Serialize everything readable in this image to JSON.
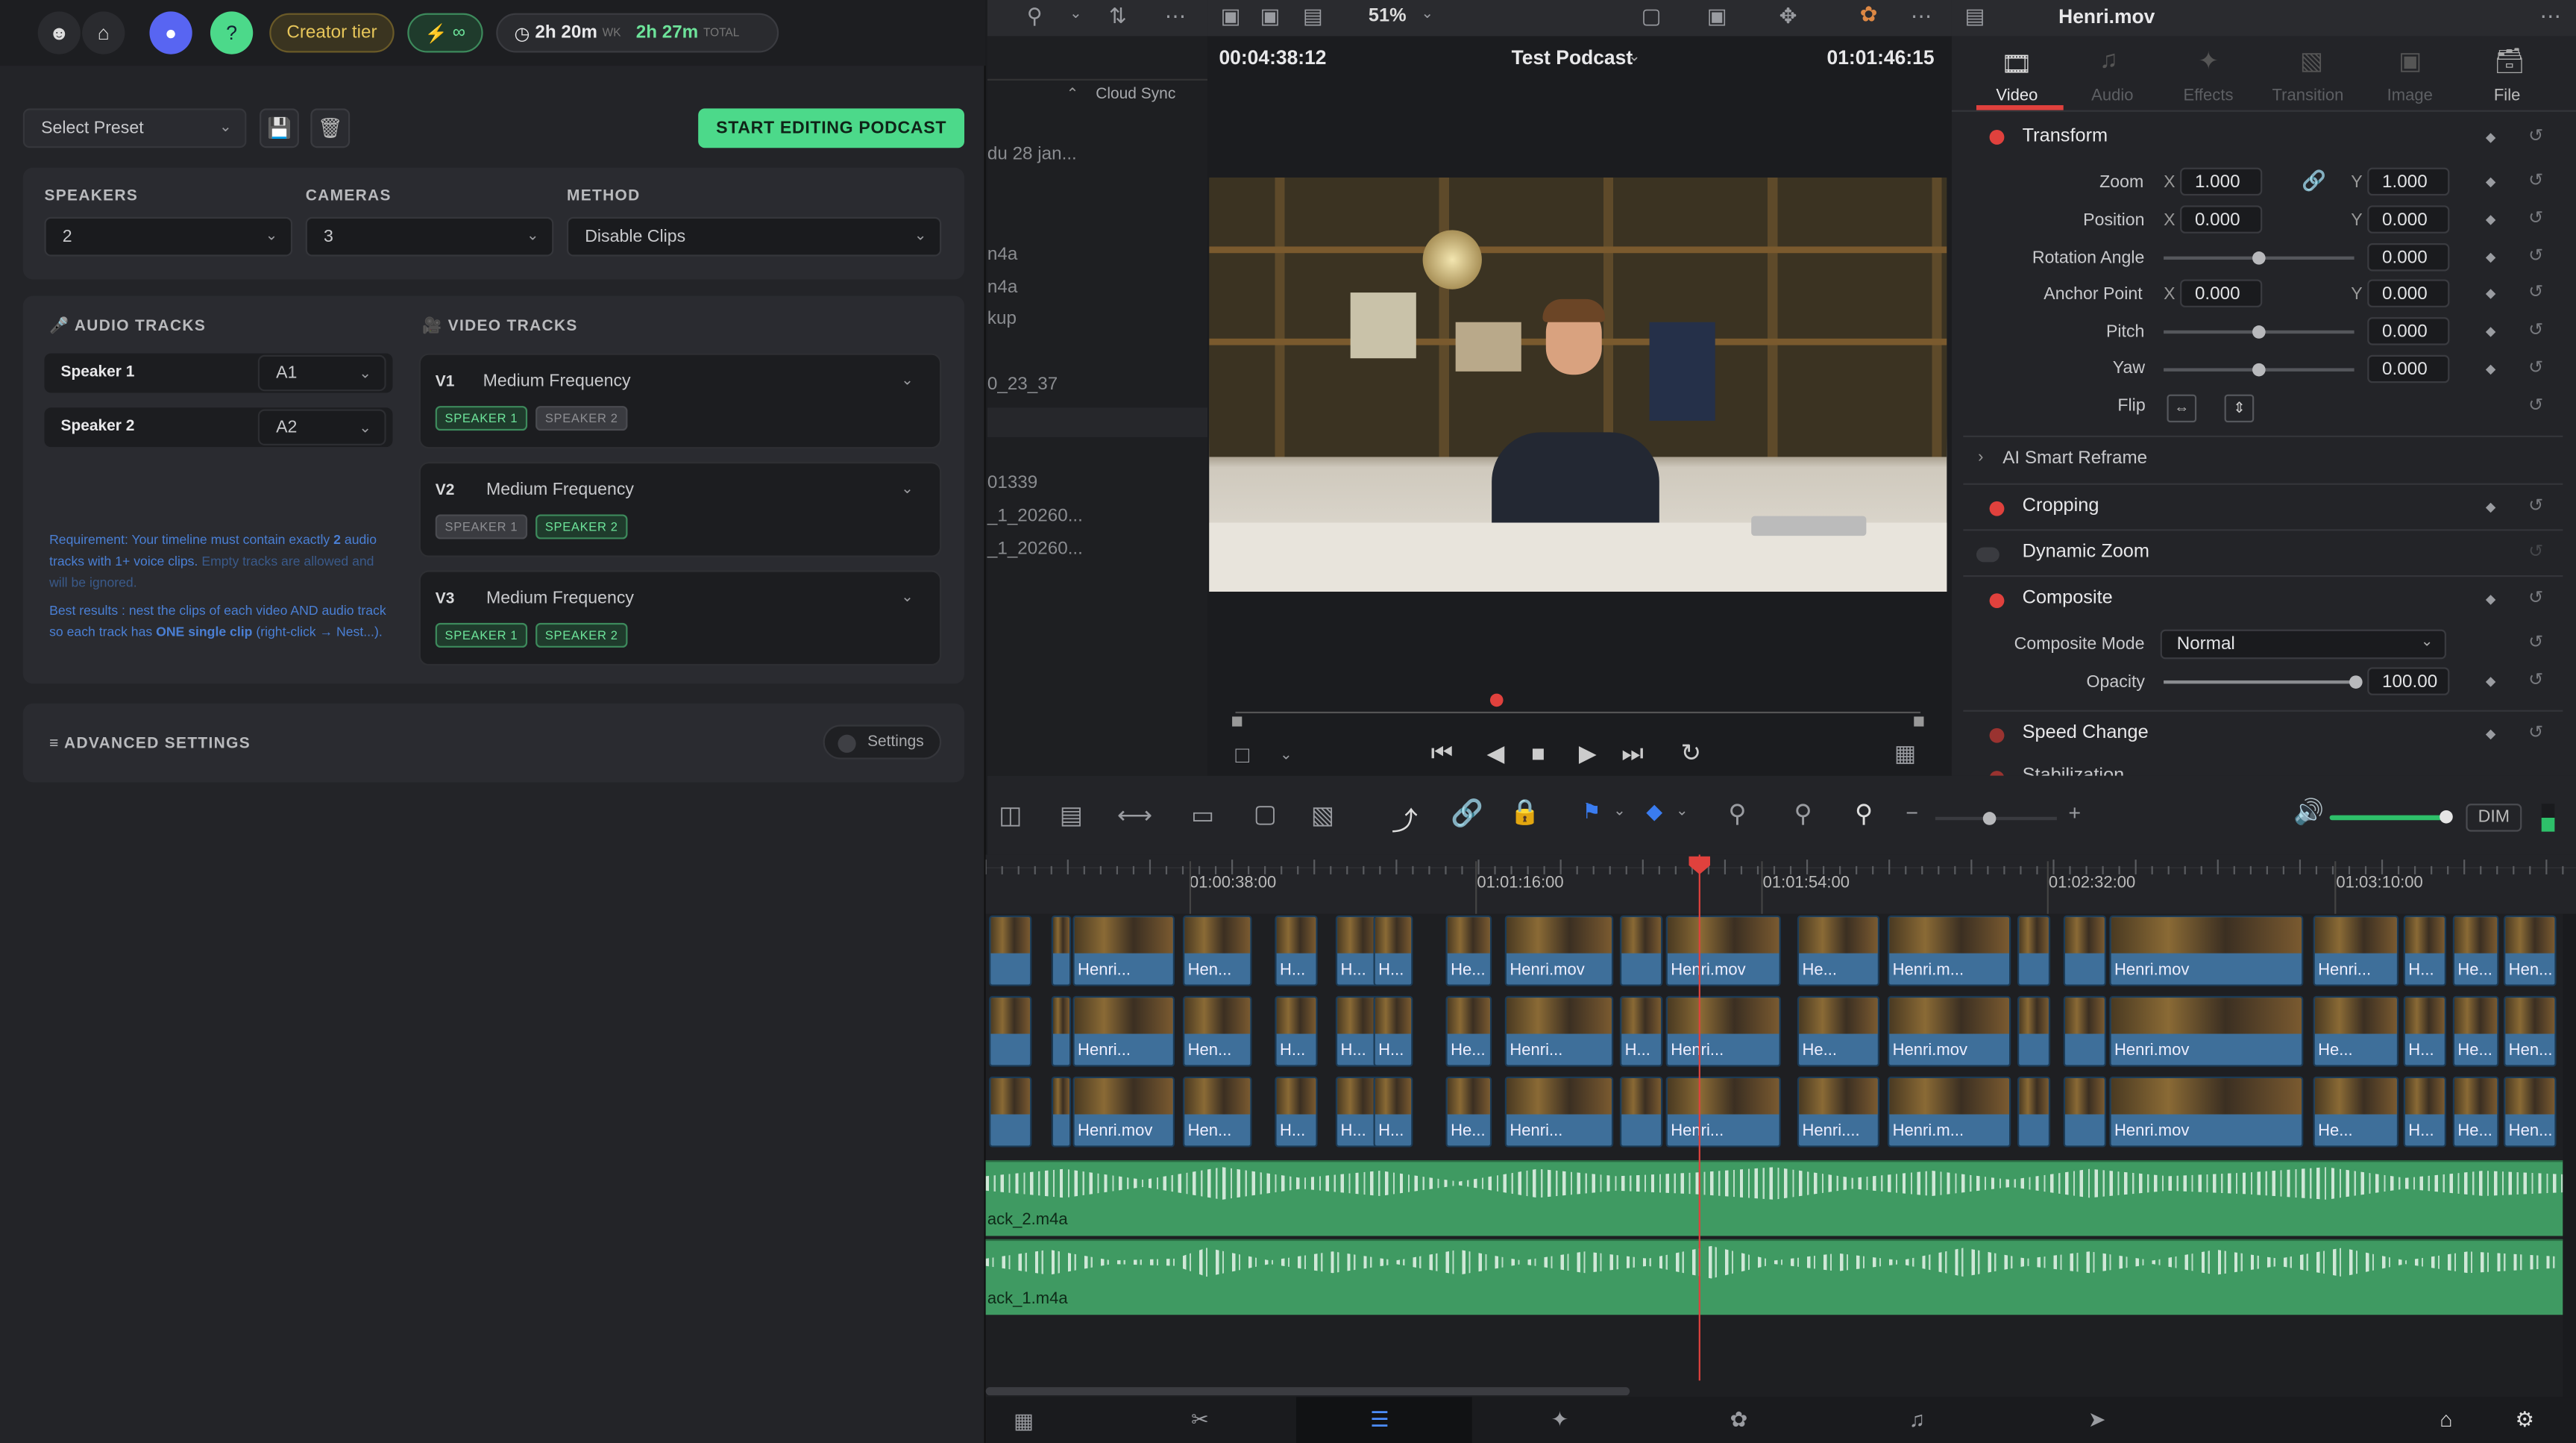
{
  "plugin": {
    "tier": "Creator tier",
    "credits": "∞",
    "time_week": "2h 20m",
    "time_week_unit": "WK",
    "time_total": "2h 27m",
    "time_total_unit": "TOTAL",
    "preset_placeholder": "Select Preset",
    "start_button": "START EDITING PODCAST",
    "speakers_label": "SPEAKERS",
    "speakers_value": "2",
    "cameras_label": "CAMERAS",
    "cameras_value": "3",
    "method_label": "METHOD",
    "method_value": "Disable Clips",
    "audio_tracks_label": "AUDIO TRACKS",
    "video_tracks_label": "VIDEO TRACKS",
    "audio_tracks": [
      {
        "name": "Speaker 1",
        "track": "A1"
      },
      {
        "name": "Speaker 2",
        "track": "A2"
      }
    ],
    "video_tracks": [
      {
        "id": "V1",
        "mode": "Medium Frequency",
        "tag1": "SPEAKER 1",
        "tag2": "SPEAKER 2"
      },
      {
        "id": "V2",
        "mode": "Medium Frequency",
        "tag1": "SPEAKER 1",
        "tag2": "SPEAKER 2"
      },
      {
        "id": "V3",
        "mode": "Medium Frequency",
        "tag1": "SPEAKER 1",
        "tag2": "SPEAKER 2"
      }
    ],
    "req_line1": "Requirement: Your timeline must contain exactly",
    "req_count": "2",
    "req_line2": "audio tracks with 1+ voice clips.",
    "req_note": "Empty tracks are allowed and will be ignored.",
    "best_1": "Best results : nest the clips of each video AND audio track so each track has",
    "best_bold": "ONE single clip",
    "best_2": "(right-click → Nest...).",
    "advanced_label": "ADVANCED SETTINGS",
    "settings_button": "Settings"
  },
  "resolve": {
    "zoom": "51%",
    "timecode_left": "00:04:38:12",
    "timeline_name": "Test Podcast",
    "timecode_right": "01:01:46:15",
    "media_column": "Cloud Sync",
    "media_items": [
      "du 28 jan...",
      "n4a",
      "n4a",
      "kup",
      "0_23_37",
      "01339",
      "_1_20260...",
      "_1_20260..."
    ],
    "inspector_title": "Henri.mov",
    "inspector_tabs": [
      "Video",
      "Audio",
      "Effects",
      "Transition",
      "Image",
      "File"
    ],
    "transform": "Transform",
    "zoom_label": "Zoom",
    "zoom_x": "1.000",
    "zoom_y": "1.000",
    "position_label": "Position",
    "pos_x": "0.000",
    "pos_y": "0.000",
    "rotation_label": "Rotation Angle",
    "rotation": "0.000",
    "anchor_label": "Anchor Point",
    "anchor_x": "0.000",
    "anchor_y": "0.000",
    "pitch_label": "Pitch",
    "pitch": "0.000",
    "yaw_label": "Yaw",
    "yaw": "0.000",
    "flip_label": "Flip",
    "ai_reframe": "AI Smart Reframe",
    "cropping": "Cropping",
    "dynamic_zoom": "Dynamic Zoom",
    "composite": "Composite",
    "composite_mode_label": "Composite Mode",
    "composite_mode": "Normal",
    "opacity_label": "Opacity",
    "opacity": "100.00",
    "speed_change": "Speed Change",
    "stabilization": "Stabilization",
    "x": "X",
    "y": "Y",
    "dim": "DIM",
    "ruler": [
      "01:00:38:00",
      "01:01:16:00",
      "01:01:54:00",
      "01:02:32:00",
      "01:03:10:00"
    ],
    "audio_track_2": "ack_2.m4a",
    "audio_track_1": "ack_1.m4a"
  },
  "colors": {
    "accent_green": "#4cd98a",
    "playhead": "#e0413d",
    "audio_green": "#3f9a62"
  }
}
